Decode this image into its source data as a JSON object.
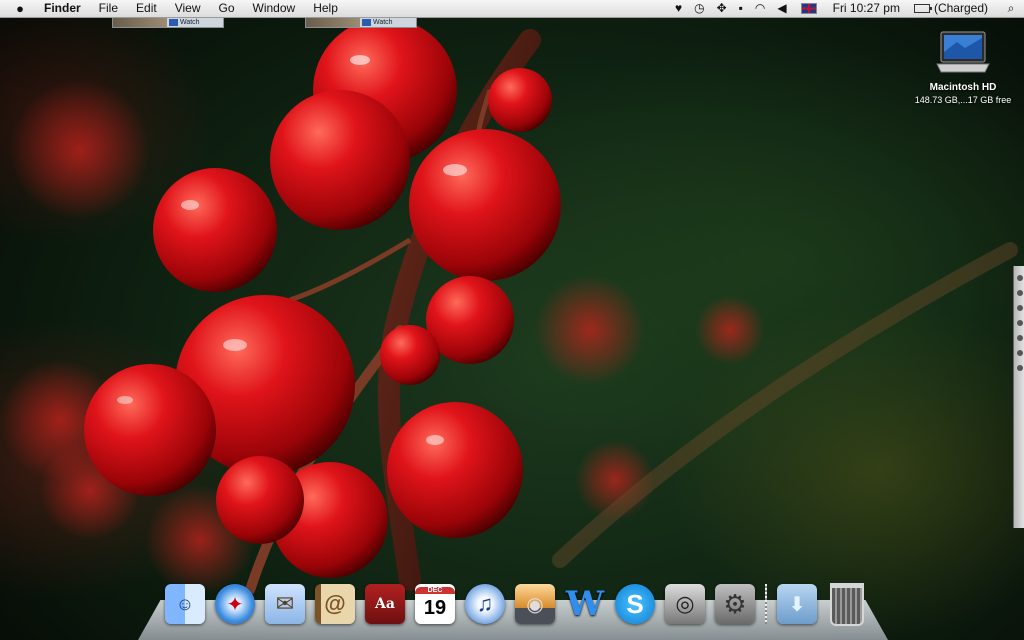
{
  "menubar": {
    "apple_icon": "apple-icon",
    "app_name": "Finder",
    "menus": [
      "File",
      "Edit",
      "View",
      "Go",
      "Window",
      "Help"
    ],
    "status_icons": [
      "heart-icon",
      "time-machine-icon",
      "spaces-icon",
      "script-icon",
      "wifi-icon",
      "volume-icon",
      "uk-flag-icon"
    ],
    "clock": "Fri 10:27 pm",
    "battery": "(Charged)",
    "spotlight_icon": "spotlight-icon"
  },
  "thumbnails": [
    {
      "label": "Watch"
    },
    {
      "label": "Watch"
    }
  ],
  "desktop": {
    "drive": {
      "name": "Macintosh HD",
      "info": "148.73 GB,...17 GB free"
    }
  },
  "dock": {
    "apps": [
      {
        "name": "Finder",
        "icon": "finder-icon",
        "glyph": "☺"
      },
      {
        "name": "Safari",
        "icon": "safari-icon",
        "glyph": "✦"
      },
      {
        "name": "Mail",
        "icon": "mail-icon",
        "glyph": "✉"
      },
      {
        "name": "Address Book",
        "icon": "address-book-icon",
        "glyph": "@"
      },
      {
        "name": "Dictionary",
        "icon": "dictionary-icon",
        "glyph": "Aa"
      },
      {
        "name": "iCal",
        "icon": "ical-icon",
        "month": "DEC",
        "day": "19"
      },
      {
        "name": "iTunes",
        "icon": "itunes-icon",
        "glyph": "♫"
      },
      {
        "name": "iPhoto",
        "icon": "iphoto-icon",
        "glyph": "◉"
      },
      {
        "name": "Word",
        "icon": "word-icon",
        "glyph": "W"
      },
      {
        "name": "Skype",
        "icon": "skype-icon",
        "glyph": "S"
      },
      {
        "name": "Image Capture",
        "icon": "camera-icon",
        "glyph": "◎"
      },
      {
        "name": "System Preferences",
        "icon": "system-preferences-icon",
        "glyph": "⚙"
      }
    ],
    "stacks": [
      {
        "name": "Downloads",
        "icon": "downloads-folder-icon",
        "glyph": "⬇"
      },
      {
        "name": "Trash",
        "icon": "trash-icon"
      }
    ]
  }
}
